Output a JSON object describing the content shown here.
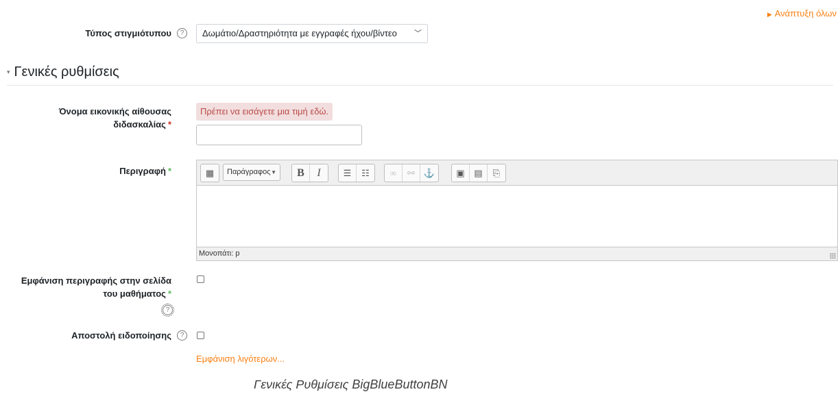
{
  "header": {
    "expand_all": "Ανάπτυξη όλων"
  },
  "instance_type": {
    "label": "Τύπος στιγμιότυπου",
    "selected": "Δωμάτιο/Δραστηριότητα με εγγραφές ήχου/βίντεο"
  },
  "section": {
    "title": "Γενικές ρυθμίσεις"
  },
  "room_name": {
    "label_line1": "Όνομα εικονικής αίθουσας",
    "label_line2": "διδασκαλίας",
    "required_mark": "*",
    "error": "Πρέπει να εισάγετε μια τιμή εδώ.",
    "value": ""
  },
  "description": {
    "label": "Περιγραφή",
    "required_mark": "*",
    "paragraph_select": "Παράγραφος",
    "path": "Μονοπάτι: p"
  },
  "show_description": {
    "label_line1": "Εμφάνιση περιγραφής στην σελίδα",
    "label_line2": "του μαθήματος",
    "required_mark": "*",
    "checked": false
  },
  "send_notification": {
    "label": "Αποστολή ειδοποίησης",
    "checked": false
  },
  "show_less": "Εμφάνιση λιγότερων...",
  "caption": "Γενικές Ρυθμίσεις BigBlueButtonBN",
  "colors": {
    "accent": "#f98012",
    "error_bg": "#f2dede",
    "error_text": "#b94a48",
    "required": "#ca3120"
  }
}
